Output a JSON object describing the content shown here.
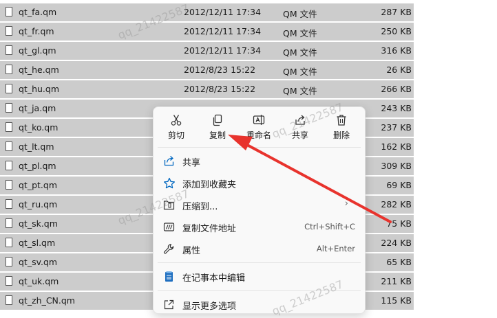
{
  "files": [
    {
      "name": "qt_fa.qm",
      "date": "2012/12/11 17:34",
      "type": "QM 文件",
      "size": "287 KB"
    },
    {
      "name": "qt_fr.qm",
      "date": "2012/12/11 17:34",
      "type": "QM 文件",
      "size": "250 KB"
    },
    {
      "name": "qt_gl.qm",
      "date": "2012/12/11 17:34",
      "type": "QM 文件",
      "size": "316 KB"
    },
    {
      "name": "qt_he.qm",
      "date": "2012/8/23 15:22",
      "type": "QM 文件",
      "size": "26 KB"
    },
    {
      "name": "qt_hu.qm",
      "date": "2012/8/23 15:22",
      "type": "QM 文件",
      "size": "266 KB"
    },
    {
      "name": "qt_ja.qm",
      "date": "",
      "type": "",
      "size": "243 KB"
    },
    {
      "name": "qt_ko.qm",
      "date": "",
      "type": "",
      "size": "237 KB"
    },
    {
      "name": "qt_lt.qm",
      "date": "",
      "type": "",
      "size": "162 KB"
    },
    {
      "name": "qt_pl.qm",
      "date": "",
      "type": "",
      "size": "309 KB"
    },
    {
      "name": "qt_pt.qm",
      "date": "",
      "type": "",
      "size": "69 KB"
    },
    {
      "name": "qt_ru.qm",
      "date": "",
      "type": "",
      "size": "282 KB"
    },
    {
      "name": "qt_sk.qm",
      "date": "",
      "type": "",
      "size": "75 KB"
    },
    {
      "name": "qt_sl.qm",
      "date": "",
      "type": "",
      "size": "224 KB"
    },
    {
      "name": "qt_sv.qm",
      "date": "",
      "type": "",
      "size": "65 KB"
    },
    {
      "name": "qt_uk.qm",
      "date": "",
      "type": "",
      "size": "211 KB"
    },
    {
      "name": "qt_zh_CN.qm",
      "date": "",
      "type": "",
      "size": "115 KB"
    }
  ],
  "context_menu": {
    "quick_actions": {
      "cut": "剪切",
      "copy": "复制",
      "rename": "重命名",
      "share": "共享",
      "delete": "删除"
    },
    "items": {
      "share": {
        "label": "共享"
      },
      "favorite": {
        "label": "添加到收藏夹"
      },
      "compress": {
        "label": "压缩到...",
        "arrow": "›"
      },
      "copy_path": {
        "label": "复制文件地址",
        "shortcut": "Ctrl+Shift+C"
      },
      "properties": {
        "label": "属性",
        "shortcut": "Alt+Enter"
      },
      "notepad": {
        "label": "在记事本中编辑"
      },
      "more": {
        "label": "显示更多选项"
      }
    }
  },
  "watermark": "qq_21422587",
  "colors": {
    "row_bg": "#cccccc",
    "accent": "#0067c0",
    "arrow": "#e8332d"
  }
}
